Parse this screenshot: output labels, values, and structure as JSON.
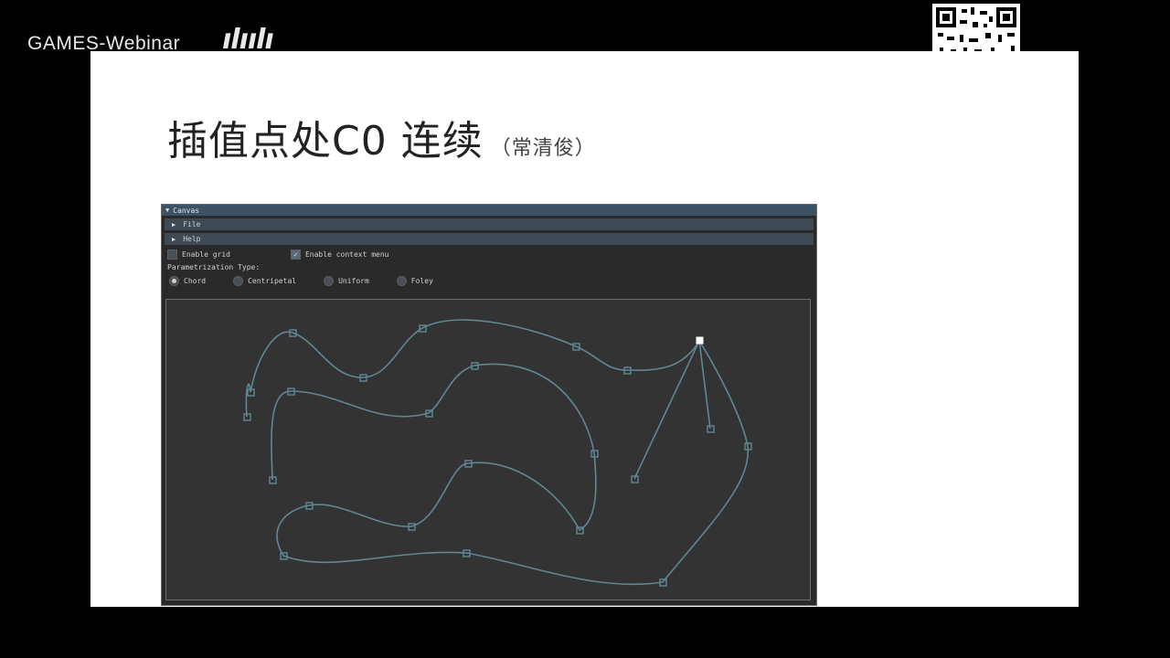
{
  "watermark": {
    "channel": "GAMES-Webinar",
    "site_logo": "bilibili"
  },
  "slide": {
    "title": "插值点处C0 连续",
    "subtitle": "（常清俊）"
  },
  "app": {
    "window_title": "Canvas",
    "sections": [
      {
        "label": "File"
      },
      {
        "label": "Help"
      }
    ],
    "options": {
      "enable_grid": {
        "label": "Enable grid",
        "checked": false
      },
      "enable_context_menu": {
        "label": "Enable context menu",
        "checked": true
      }
    },
    "parametrization": {
      "label": "Parametrization Type:",
      "choices": [
        {
          "label": "Chord",
          "selected": true
        },
        {
          "label": "Centripetal",
          "selected": false
        },
        {
          "label": "Uniform",
          "selected": false
        },
        {
          "label": "Foley",
          "selected": false
        }
      ]
    },
    "colors": {
      "curve": "#5f8794",
      "point": "#5f8794",
      "canvas_bg": "#333333",
      "selected_point": "#ffffff"
    }
  }
}
